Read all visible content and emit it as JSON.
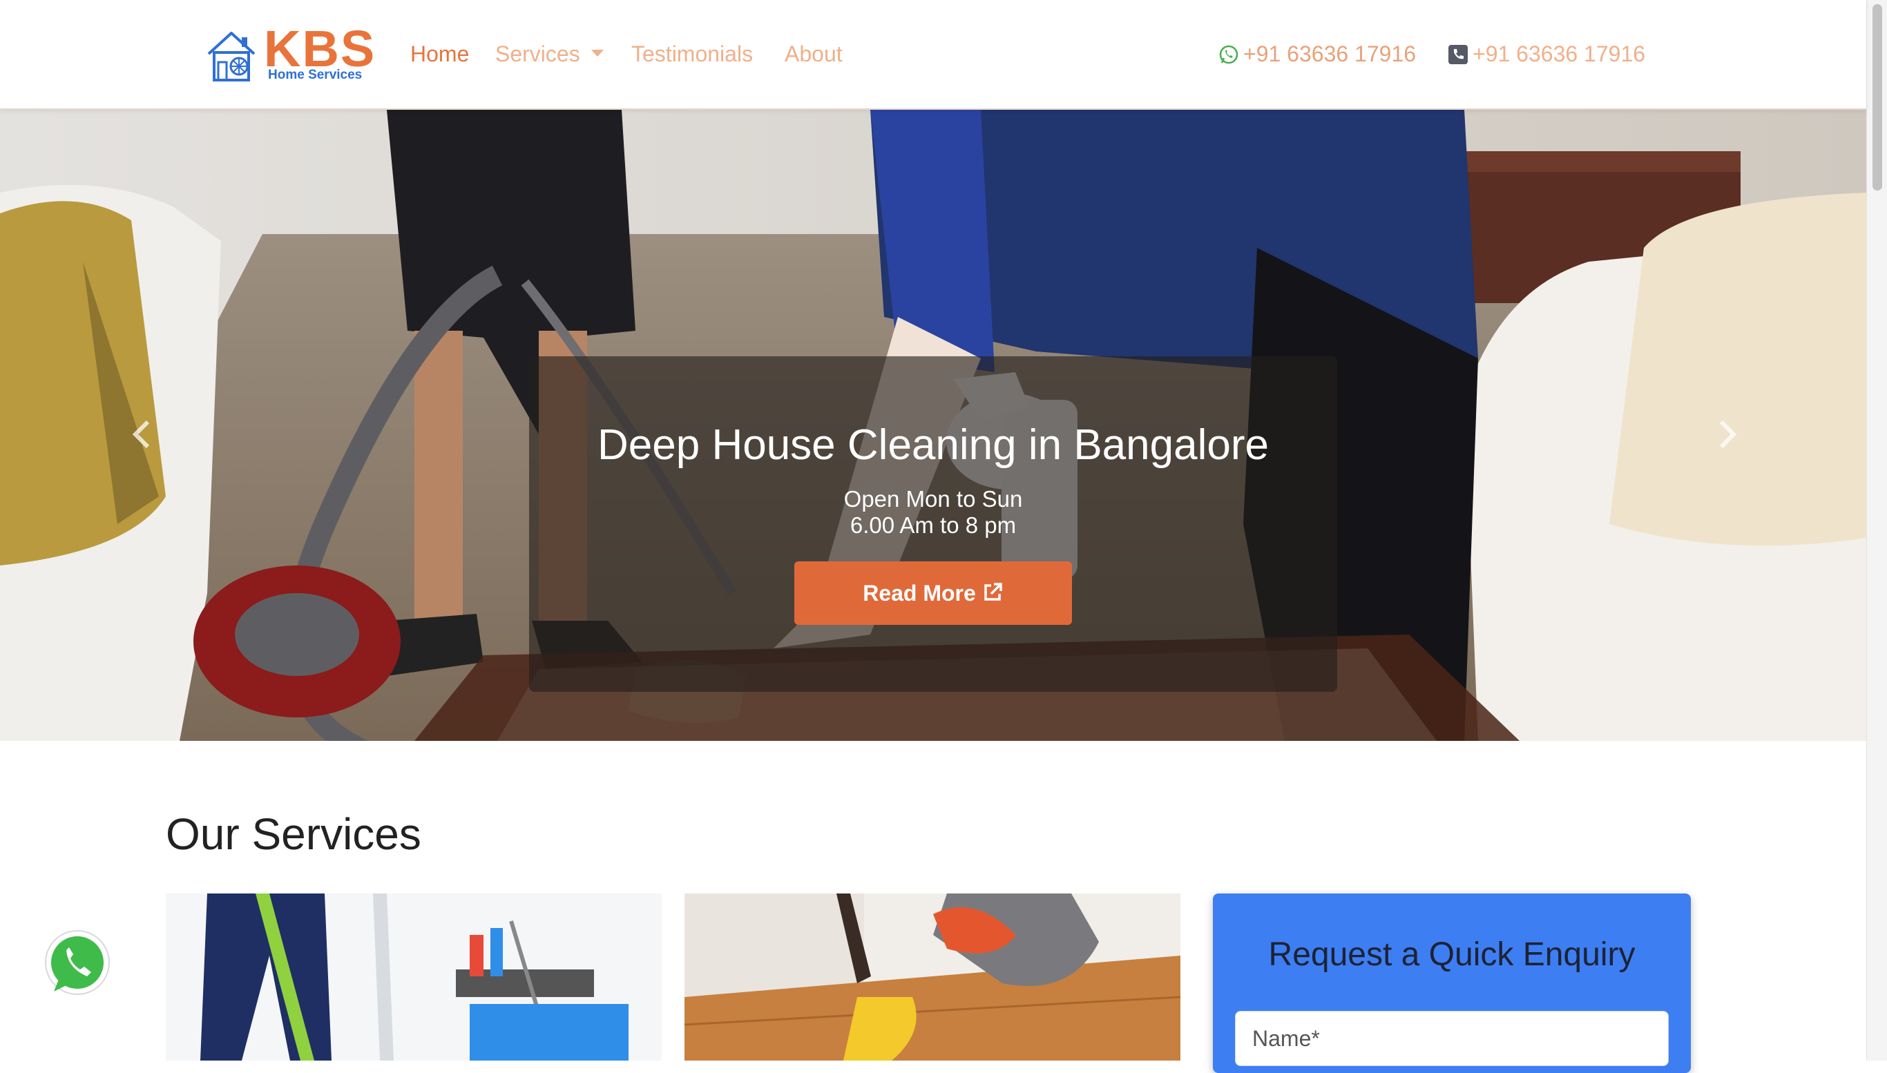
{
  "brand": {
    "name": "KBS",
    "tagline": "Home Services",
    "accent_color": "#e8743b",
    "secondary_color": "#2f6fd6"
  },
  "nav": {
    "items": [
      {
        "label": "Home",
        "active": true
      },
      {
        "label": "Services",
        "dropdown": true
      },
      {
        "label": "Testimonials"
      },
      {
        "label": "About"
      }
    ],
    "whatsapp_phone": "+91 63636 17916",
    "call_phone": "+91 63636 17916"
  },
  "hero": {
    "title": "Deep House Cleaning in Bangalore",
    "line1": "Open Mon to Sun",
    "line2": "6.00 Am to 8 pm",
    "button_label": "Read More",
    "button_color": "#e0693a"
  },
  "services": {
    "heading": "Our Services"
  },
  "enquiry": {
    "title": "Request a Quick Enquiry",
    "name_placeholder": "Name*",
    "panel_color": "#3d7ef2"
  },
  "icons": {
    "whatsapp": "whatsapp-icon",
    "phone": "phone-square-icon",
    "external": "external-link-icon",
    "logo": "house-snowflake-icon"
  }
}
